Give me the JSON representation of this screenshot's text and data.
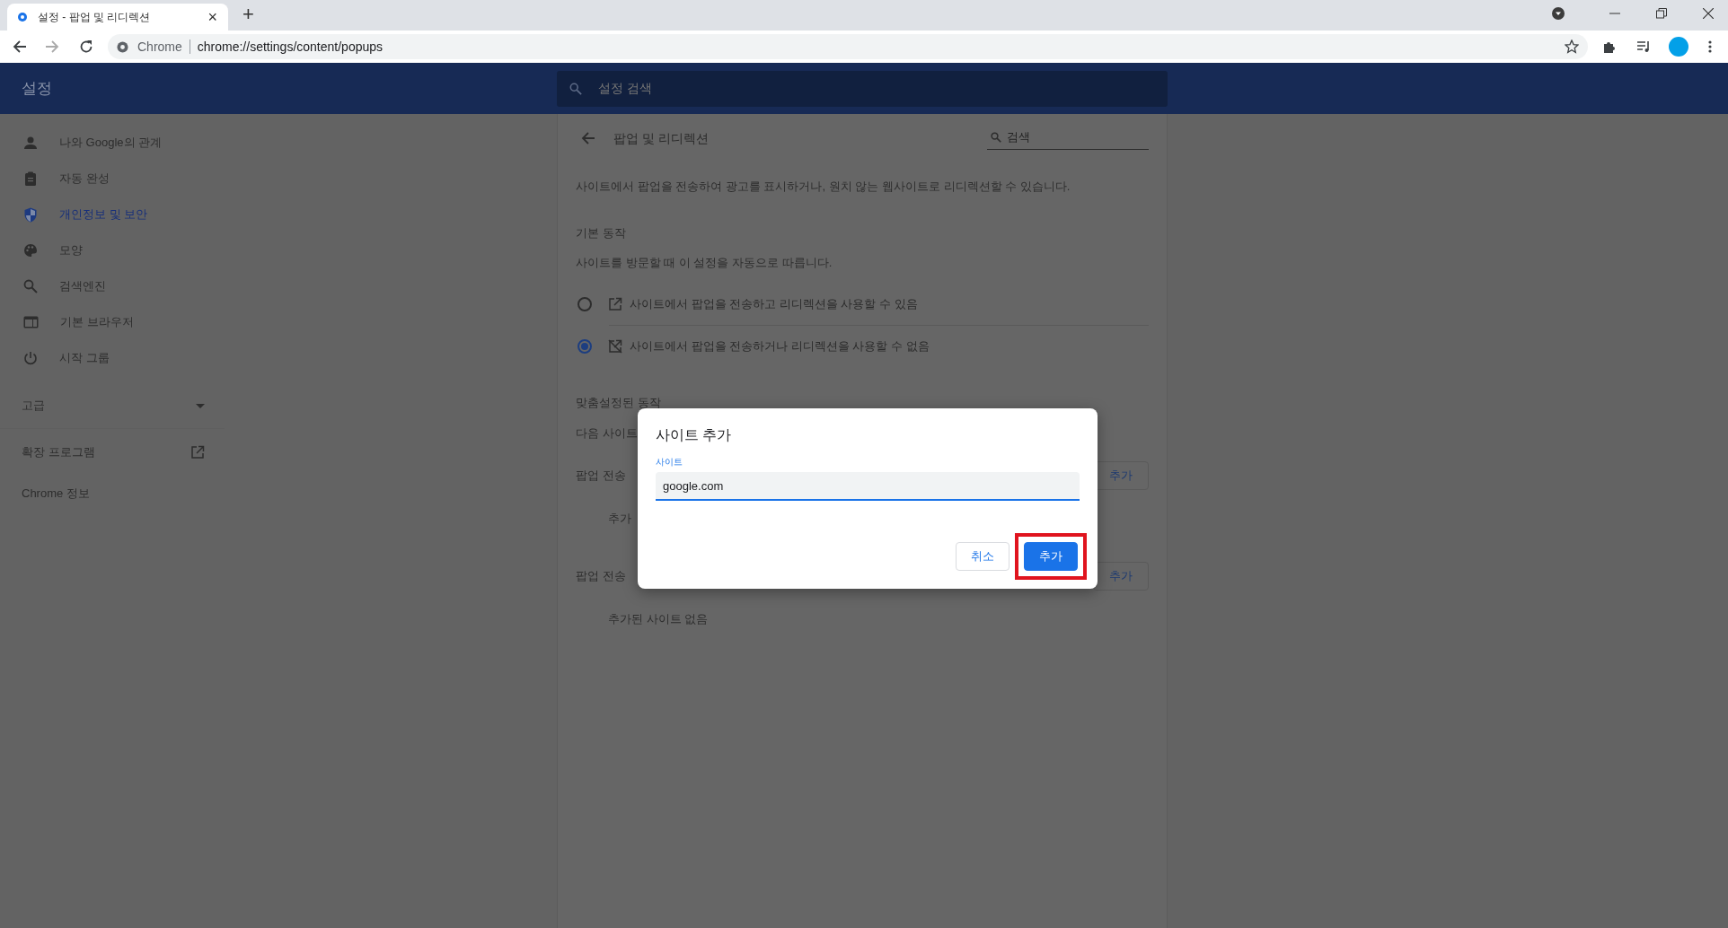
{
  "browser": {
    "tab": {
      "title": "설정 - 팝업 및 리디렉션",
      "close": "×"
    },
    "new_tab": "+",
    "address": {
      "site": "Chrome",
      "url": "chrome://settings/content/popups"
    }
  },
  "header": {
    "title": "설정",
    "search_placeholder": "설정 검색"
  },
  "sidebar": {
    "items": [
      {
        "label": "나와 Google의 관계",
        "selected": false
      },
      {
        "label": "자동 완성",
        "selected": false
      },
      {
        "label": "개인정보 및 보안",
        "selected": true
      },
      {
        "label": "모양",
        "selected": false
      },
      {
        "label": "검색엔진",
        "selected": false
      },
      {
        "label": "기본 브라우저",
        "selected": false
      },
      {
        "label": "시작 그룹",
        "selected": false
      }
    ],
    "advanced": "고급",
    "links": [
      {
        "label": "확장 프로그램",
        "external": true
      },
      {
        "label": "Chrome 정보",
        "external": false
      }
    ]
  },
  "page": {
    "title": "팝업 및 리디렉션",
    "search": "검색",
    "description": "사이트에서 팝업을 전송하여 광고를 표시하거나, 원치 않는 웹사이트로 리디렉션할 수 있습니다.",
    "default_heading": "기본 동작",
    "default_sub": "사이트를 방문할 때 이 설정을 자동으로 따릅니다.",
    "options": [
      {
        "label": "사이트에서 팝업을 전송하고 리디렉션을 사용할 수 있음",
        "selected": false
      },
      {
        "label": "사이트에서 팝업을 전송하거나 리디렉션을 사용할 수 없음",
        "selected": true
      }
    ],
    "custom_heading": "맞춤설정된 동작",
    "custom_sub": "다음 사이트",
    "sections": [
      {
        "title": "팝업 전송",
        "button": "추가",
        "empty": "추가"
      },
      {
        "title": "팝업 전송",
        "button": "추가",
        "empty": "추가된 사이트 없음"
      }
    ]
  },
  "dialog": {
    "title": "사이트 추가",
    "field_label": "사이트",
    "value": "google.com",
    "buttons": [
      {
        "label": "취소",
        "kind": "secondary",
        "highlighted": false
      },
      {
        "label": "추가",
        "kind": "primary",
        "highlighted": true
      }
    ]
  }
}
